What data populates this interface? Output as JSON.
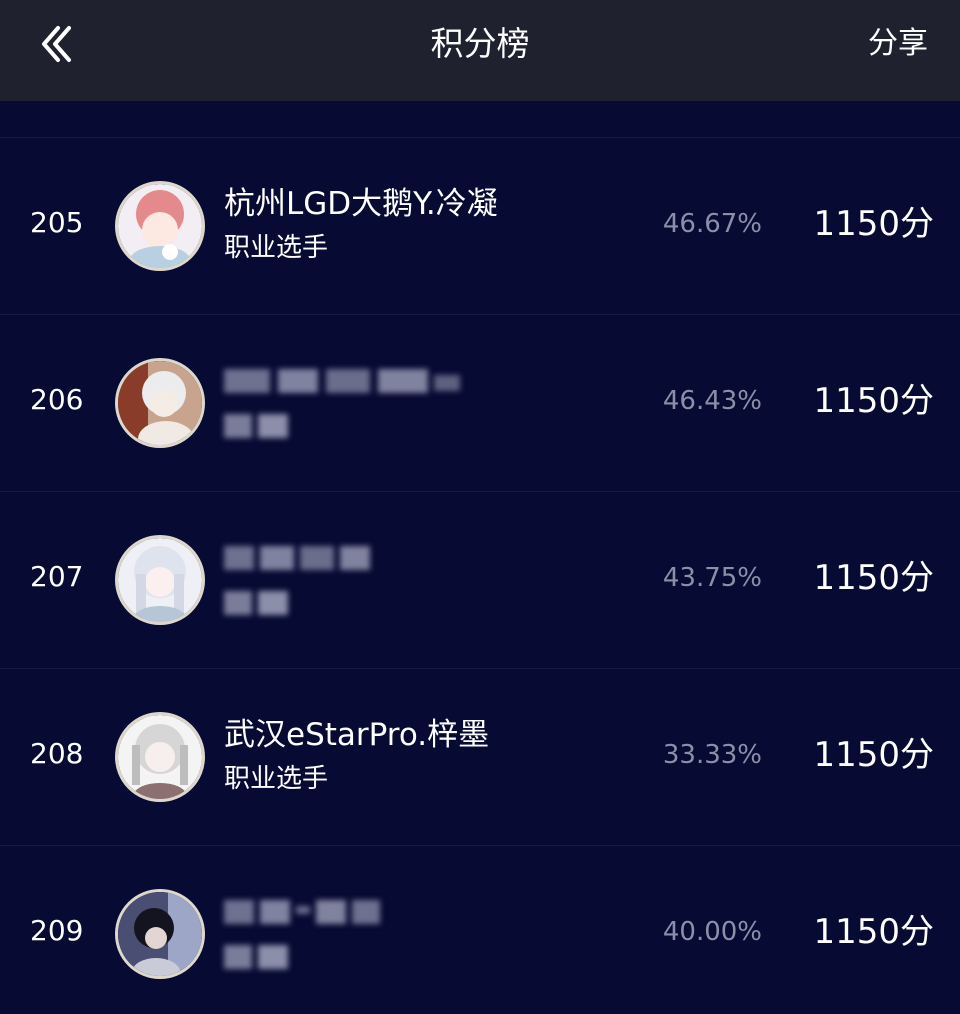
{
  "header": {
    "title": "积分榜",
    "share_label": "分享",
    "back_icon": "chevron-left-icon"
  },
  "colors": {
    "header_bg": "#1f222e",
    "page_bg": "#070a33",
    "rate_text": "#8b8fa8"
  },
  "rows": [
    {
      "rank": "205",
      "name": "杭州LGD大鹅Y.冷凝",
      "role": "职业选手",
      "rate": "46.67%",
      "score": "1150分",
      "obscured": false
    },
    {
      "rank": "206",
      "name": "",
      "role": "",
      "rate": "46.43%",
      "score": "1150分",
      "obscured": true
    },
    {
      "rank": "207",
      "name": "",
      "role": "",
      "rate": "43.75%",
      "score": "1150分",
      "obscured": true
    },
    {
      "rank": "208",
      "name": "武汉eStarPro.梓墨",
      "role": "职业选手",
      "rate": "33.33%",
      "score": "1150分",
      "obscured": false
    },
    {
      "rank": "209",
      "name": "",
      "role": "",
      "rate": "40.00%",
      "score": "1150分",
      "obscured": true
    }
  ]
}
